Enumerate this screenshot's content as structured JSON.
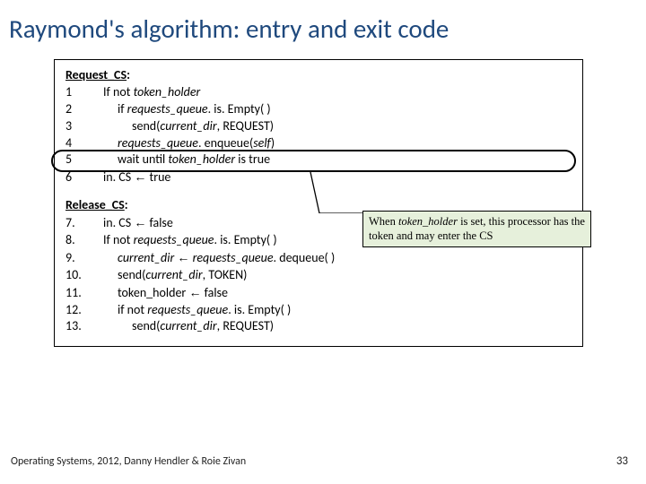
{
  "title": "Raymond's algorithm: entry and exit code",
  "request": {
    "heading": "Request_CS",
    "lines": [
      {
        "n": "1",
        "pre": "If not ",
        "it": "token_holder",
        "post": "",
        "ind": 1
      },
      {
        "n": "2",
        "pre": "if ",
        "it": "requests_queue",
        "post": ". is. Empty( )",
        "ind": 2
      },
      {
        "n": "3",
        "pre": "send(",
        "it": "current_dir",
        "post": ", REQUEST)",
        "ind": 3
      },
      {
        "n": "4",
        "pre": "",
        "it": "requests_queue",
        "post": ". enqueue(",
        "it2": "self",
        "post2": ")",
        "ind": 2
      },
      {
        "n": "5",
        "pre": "wait until ",
        "it": "token_holder",
        "post": " is true",
        "ind": 2
      },
      {
        "n": "6",
        "pre": "in. CS ",
        "arrow": "←",
        "post": " true",
        "ind": 1
      }
    ]
  },
  "release": {
    "heading": "Release_CS",
    "lines": [
      {
        "n": "7.",
        "pre": "in. CS ",
        "arrow": "←",
        "post": " false",
        "ind": 1
      },
      {
        "n": "8.",
        "pre": "If not ",
        "it": "requests_queue",
        "post": ". is. Empty( )",
        "ind": 1
      },
      {
        "n": "9.",
        "pre": "",
        "it": "current_dir ",
        "arrow": "←",
        "it2": " requests_queue",
        "post": ". dequeue( )",
        "ind": 2
      },
      {
        "n": "10.",
        "pre": "send(",
        "it": "current_dir",
        "post": ", TOKEN)",
        "ind": 2
      },
      {
        "n": "11.",
        "pre": "token_holder ",
        "arrow": "←",
        "post": " false",
        "ind": 2
      },
      {
        "n": "12.",
        "pre": "if not ",
        "it": "requests_queue",
        "post": ". is. Empty( )",
        "ind": 2
      },
      {
        "n": "13.",
        "pre": "send(",
        "it": "current_dir",
        "post": ", REQUEST)",
        "ind": 3
      }
    ]
  },
  "callout": {
    "text_a": "When ",
    "it": "token_holder",
    "text_b": " is set, this processor has the token and may enter the CS"
  },
  "footer": "Operating Systems, 2012, Danny Hendler & Roie Zivan",
  "page": "33"
}
